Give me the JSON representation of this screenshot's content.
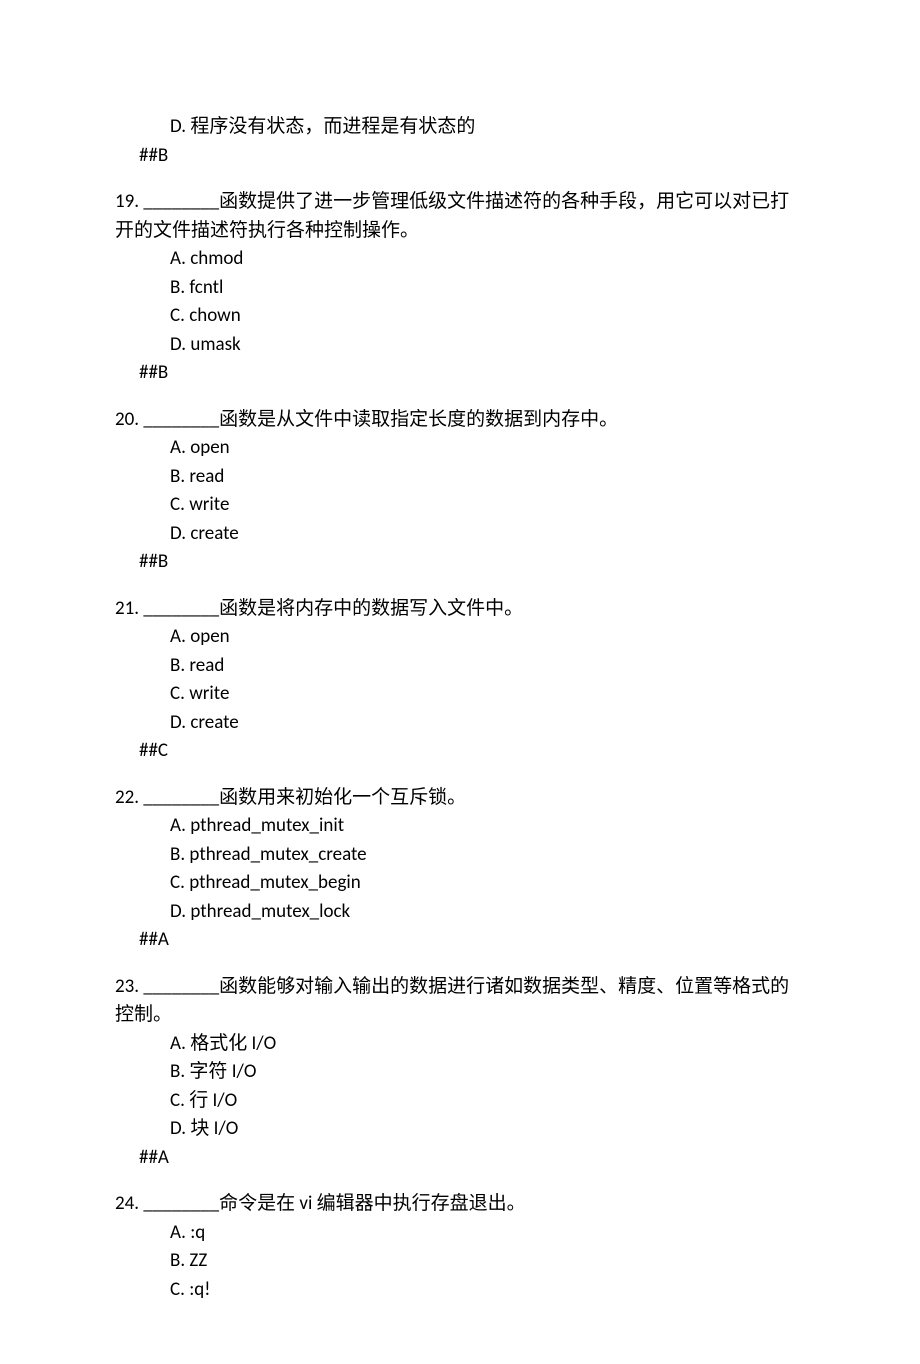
{
  "orphan": {
    "optionD": "D. 程序没有状态，而进程是有状态的",
    "answer": "##B"
  },
  "q19": {
    "stem_before": "19. ",
    "blank": "________",
    "stem_after": "函数提供了进一步管理低级文件描述符的各种手段，用它可以对已打开的文件描述符执行各种控制操作。",
    "A": "A. chmod",
    "B": "B. fcntl",
    "C": "C. chown",
    "D": "D. umask",
    "answer": "##B"
  },
  "q20": {
    "stem_before": "20. ",
    "blank": "________",
    "stem_after": "函数是从文件中读取指定长度的数据到内存中。",
    "A": "A. open",
    "B": "B. read",
    "C": "C. write",
    "D": "D. create",
    "answer": "##B"
  },
  "q21": {
    "stem_before": "21. ",
    "blank": "________",
    "stem_after": "函数是将内存中的数据写入文件中。",
    "A": "A. open",
    "B": "B. read",
    "C": "C. write",
    "D": "D. create",
    "answer": "##C"
  },
  "q22": {
    "stem_before": "22. ",
    "blank": "________",
    "stem_after": "函数用来初始化一个互斥锁。",
    "A": "A. pthread_mutex_init",
    "B": "B. pthread_mutex_create",
    "C": "C. pthread_mutex_begin",
    "D": "D. pthread_mutex_lock",
    "answer": "##A"
  },
  "q23": {
    "stem_before": "23. ",
    "blank": "________",
    "stem_after": "函数能够对输入输出的数据进行诸如数据类型、精度、位置等格式的控制。",
    "A": "A. 格式化 I/O",
    "B": "B. 字符 I/O",
    "C": "C. 行 I/O",
    "D": "D. 块 I/O",
    "answer": "##A"
  },
  "q24": {
    "stem_before": "24. ",
    "blank": "________",
    "stem_after": "命令是在 vi 编辑器中执行存盘退出。",
    "A": "A. :q",
    "B": "B. ZZ",
    "C": "C. :q!"
  }
}
